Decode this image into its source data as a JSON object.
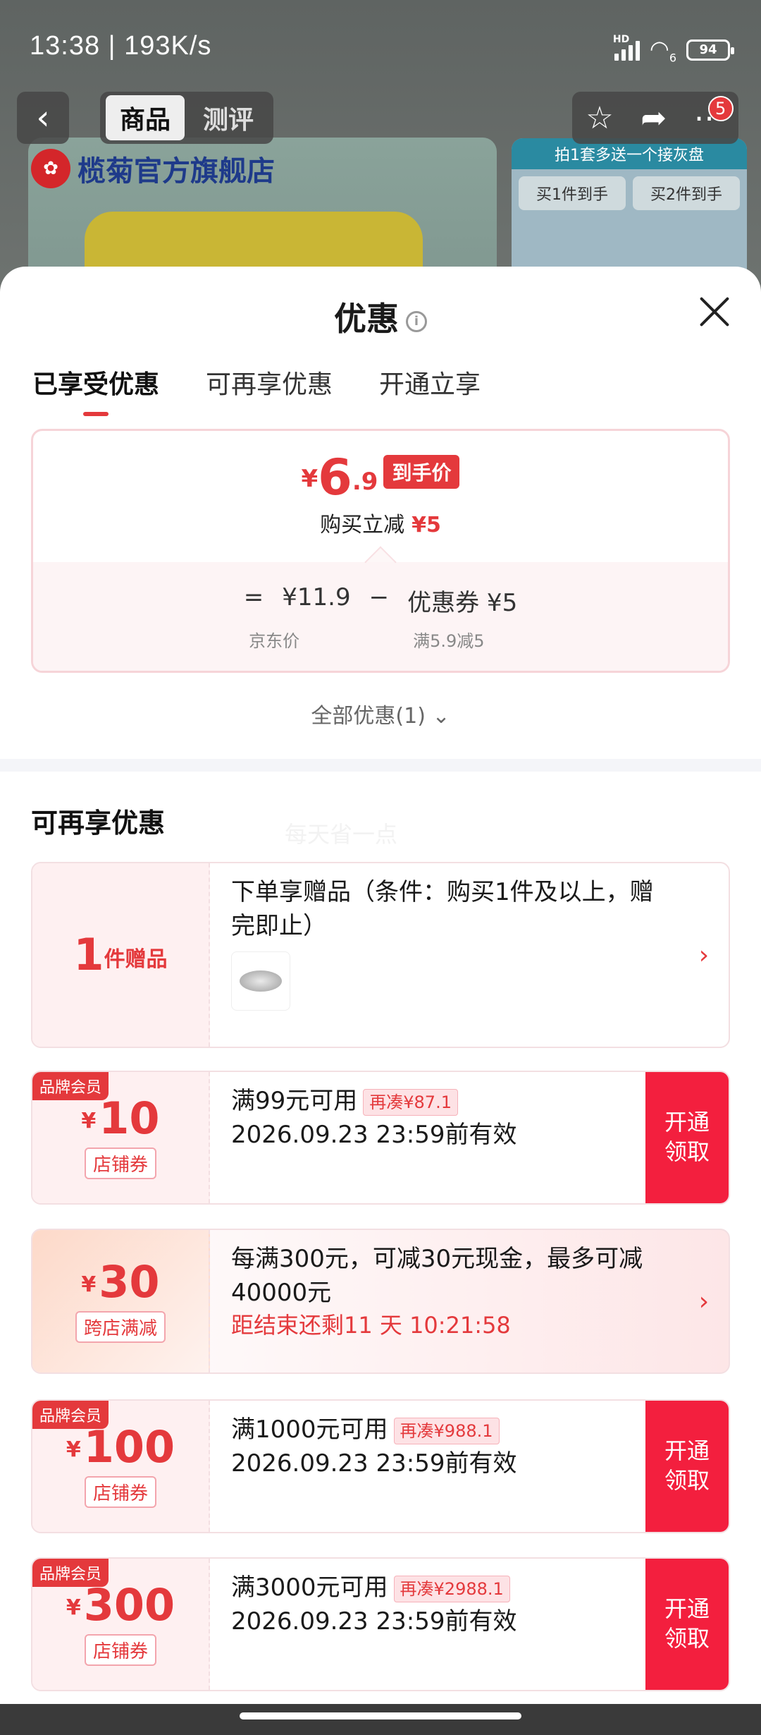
{
  "status_bar": {
    "time_speed": "13:38 | 193K/s",
    "network_label": "HD",
    "wifi_label": "6",
    "battery": "94"
  },
  "nav": {
    "tab_goods": "商品",
    "tab_review": "测评",
    "cart_badge": "5"
  },
  "background": {
    "store_name": "榄菊官方旗舰店",
    "promo_head": "拍1套多送一个接灰盘",
    "promo_buy1": "买1件到手",
    "promo_buy2": "买2件到手"
  },
  "sheet": {
    "title": "优惠",
    "tabs": [
      "已享受优惠",
      "可再享优惠",
      "开通立享"
    ],
    "price": {
      "yen": "¥",
      "int": "6",
      "dec": ".9",
      "tag": "到手价",
      "sub_label": "购买立减",
      "sub_value": "¥5"
    },
    "calc": {
      "eq": "=",
      "jd_price": "¥11.9",
      "minus": "−",
      "coupon": "优惠券 ¥5",
      "jd_label": "京东价",
      "coupon_label": "满5.9减5"
    },
    "all_discounts": "全部优惠(1)",
    "section_title": "可再享优惠",
    "watermark": "每天省一点",
    "gift": {
      "num": "1",
      "unit": "件赠品",
      "text": "下单享赠品（条件：购买1件及以上，赠完即止）"
    },
    "coupons": [
      {
        "member": "品牌会员",
        "yen": "¥",
        "amount": "10",
        "type": "店铺券",
        "cond": "满99元可用",
        "gap": "再凑¥87.1",
        "valid": "2026.09.23 23:59前有效",
        "btn1": "开通",
        "btn2": "领取"
      },
      {
        "member": "品牌会员",
        "yen": "¥",
        "amount": "100",
        "type": "店铺券",
        "cond": "满1000元可用",
        "gap": "再凑¥988.1",
        "valid": "2026.09.23 23:59前有效",
        "btn1": "开通",
        "btn2": "领取"
      },
      {
        "member": "品牌会员",
        "yen": "¥",
        "amount": "300",
        "type": "店铺券",
        "cond": "满3000元可用",
        "gap": "再凑¥2988.1",
        "valid": "2026.09.23 23:59前有效",
        "btn1": "开通",
        "btn2": "领取"
      }
    ],
    "cross": {
      "yen": "¥",
      "amount": "30",
      "type": "跨店满减",
      "desc": "每满300元，可减30元现金，最多可减40000元",
      "countdown": "距结束还剩11 天 10:21:58"
    }
  },
  "colors": {
    "accent": "#e4393c",
    "button": "#f31f3e"
  }
}
